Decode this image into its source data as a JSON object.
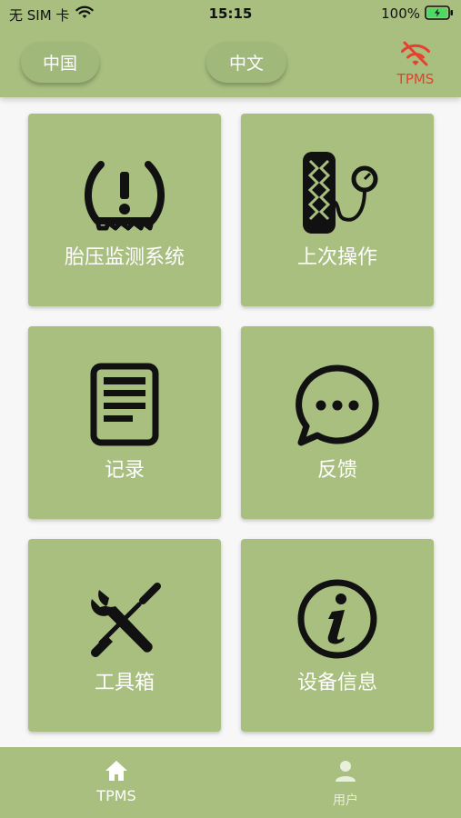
{
  "status_bar": {
    "carrier": "无 SIM 卡",
    "time": "15:15",
    "battery": "100%"
  },
  "header": {
    "region_button": "中国",
    "language_button": "中文",
    "connection_label": "TPMS",
    "connection_icon": "wifi-off-icon",
    "connection_color": "#e8402f"
  },
  "tiles": [
    {
      "label": "胎压监测系统",
      "icon": "tire-pressure-warning-icon"
    },
    {
      "label": "上次操作",
      "icon": "tire-gauge-icon"
    },
    {
      "label": "记录",
      "icon": "document-icon"
    },
    {
      "label": "反馈",
      "icon": "chat-bubble-icon"
    },
    {
      "label": "工具箱",
      "icon": "wrench-screwdriver-icon"
    },
    {
      "label": "设备信息",
      "icon": "info-icon"
    }
  ],
  "bottom_nav": {
    "items": [
      {
        "label": "TPMS",
        "icon": "home-icon"
      },
      {
        "label": "用户",
        "icon": "user-icon"
      }
    ]
  },
  "colors": {
    "accent": "#a8bf80",
    "background": "#f7f7f7",
    "tile_text": "#ffffff",
    "alert": "#e8402f"
  }
}
